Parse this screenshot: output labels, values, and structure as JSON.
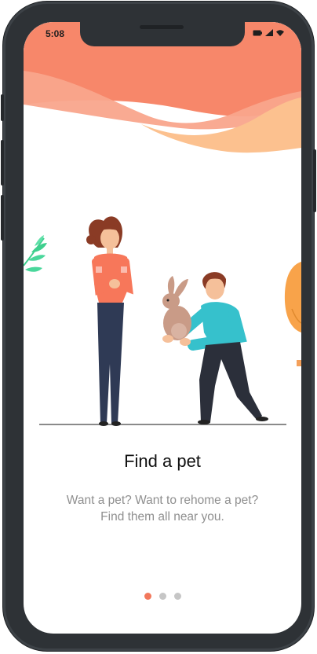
{
  "status_bar": {
    "time": "5:08",
    "icons": [
      "battery-icon",
      "signal-icon",
      "wifi-icon"
    ]
  },
  "onboarding": {
    "title": "Find a pet",
    "description_line1": "Want a pet? Want to rehome a pet?",
    "description_line2": "Find them all near you.",
    "current_page": 1,
    "total_pages": 3
  },
  "colors": {
    "accent": "#f2785c",
    "header_wave": "#f7876a",
    "header_wave_light": "#fcb98e",
    "dot_inactive": "#c6c6c6"
  }
}
